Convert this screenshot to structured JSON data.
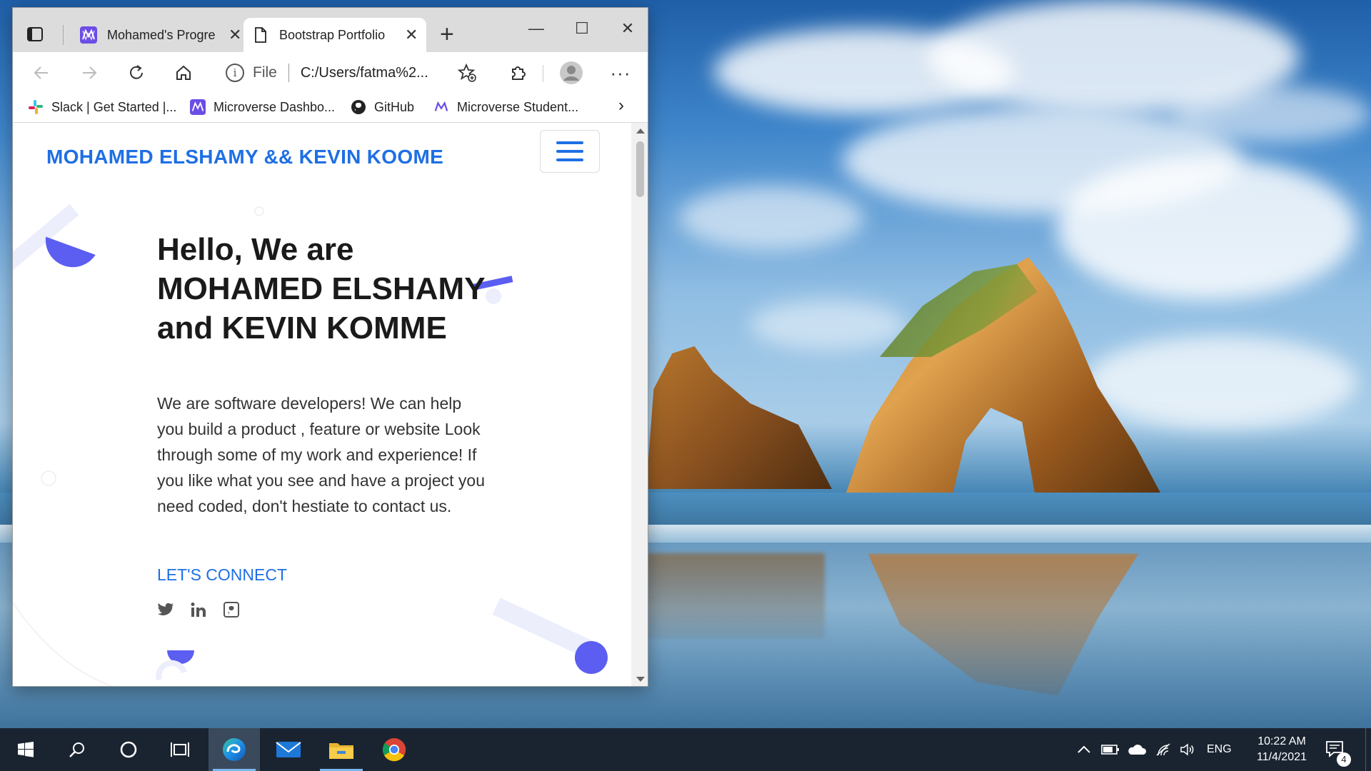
{
  "browser": {
    "tabs": [
      {
        "title": "Mohamed's Progre",
        "favicon": "microverse-icon",
        "active": false
      },
      {
        "title": "Bootstrap Portfolio",
        "favicon": "document-icon",
        "active": true
      }
    ],
    "address": {
      "scheme_label": "File",
      "url": "C:/Users/fatma%2..."
    },
    "bookmarks": [
      {
        "label": "Slack | Get Started |...",
        "icon": "slack-icon"
      },
      {
        "label": "Microverse Dashbo...",
        "icon": "microverse-icon"
      },
      {
        "label": "GitHub",
        "icon": "github-icon"
      },
      {
        "label": "Microverse Student...",
        "icon": "microverse-icon"
      }
    ]
  },
  "page": {
    "brand": "MOHAMED ELSHAMY && KEVIN KOOME",
    "hero_title": "Hello, We are MOHAMED ELSHAMY and KEVIN KOMME",
    "hero_text": "We are software developers! We can help you build a product , feature or website Look through some of my work and experience! If you like what you see and have a project you need coded, don't hestiate to contact us.",
    "cta": "LET'S CONNECT",
    "social": [
      "twitter-icon",
      "linkedin-icon",
      "github-icon"
    ]
  },
  "taskbar": {
    "apps": [
      "start-icon",
      "search-icon",
      "cortana-icon",
      "task-view-icon",
      "edge-icon",
      "mail-icon",
      "file-explorer-icon",
      "chrome-icon"
    ],
    "language": "ENG",
    "time": "10:22 AM",
    "date": "11/4/2021",
    "notification_count": "4"
  },
  "colors": {
    "brand_blue": "#1f6fe5",
    "accent_purple": "#5b5ef0",
    "taskbar": "#1a2431"
  }
}
